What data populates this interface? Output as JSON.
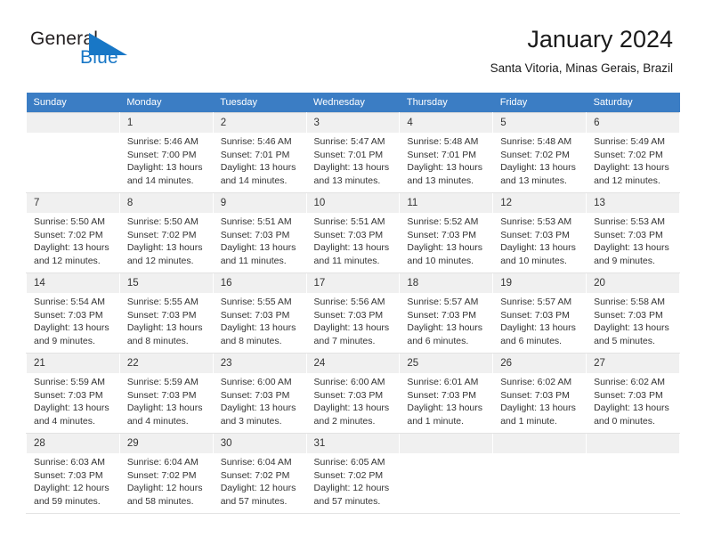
{
  "brand": {
    "name_part1": "General",
    "name_part2": "Blue",
    "logo_icon": "triangle-logo-icon",
    "accent_color": "#1877c6"
  },
  "header": {
    "title": "January 2024",
    "subtitle": "Santa Vitoria, Minas Gerais, Brazil"
  },
  "calendar": {
    "header_bg": "#3b7dc4",
    "weekday_headers": [
      "Sunday",
      "Monday",
      "Tuesday",
      "Wednesday",
      "Thursday",
      "Friday",
      "Saturday"
    ],
    "labels": {
      "sunrise": "Sunrise:",
      "sunset": "Sunset:",
      "daylight": "Daylight:"
    },
    "weeks": [
      [
        {
          "day": "",
          "sunrise": "",
          "sunset": "",
          "daylight_line1": "",
          "daylight_line2": ""
        },
        {
          "day": "1",
          "sunrise": "Sunrise: 5:46 AM",
          "sunset": "Sunset: 7:00 PM",
          "daylight_line1": "Daylight: 13 hours",
          "daylight_line2": "and 14 minutes."
        },
        {
          "day": "2",
          "sunrise": "Sunrise: 5:46 AM",
          "sunset": "Sunset: 7:01 PM",
          "daylight_line1": "Daylight: 13 hours",
          "daylight_line2": "and 14 minutes."
        },
        {
          "day": "3",
          "sunrise": "Sunrise: 5:47 AM",
          "sunset": "Sunset: 7:01 PM",
          "daylight_line1": "Daylight: 13 hours",
          "daylight_line2": "and 13 minutes."
        },
        {
          "day": "4",
          "sunrise": "Sunrise: 5:48 AM",
          "sunset": "Sunset: 7:01 PM",
          "daylight_line1": "Daylight: 13 hours",
          "daylight_line2": "and 13 minutes."
        },
        {
          "day": "5",
          "sunrise": "Sunrise: 5:48 AM",
          "sunset": "Sunset: 7:02 PM",
          "daylight_line1": "Daylight: 13 hours",
          "daylight_line2": "and 13 minutes."
        },
        {
          "day": "6",
          "sunrise": "Sunrise: 5:49 AM",
          "sunset": "Sunset: 7:02 PM",
          "daylight_line1": "Daylight: 13 hours",
          "daylight_line2": "and 12 minutes."
        }
      ],
      [
        {
          "day": "7",
          "sunrise": "Sunrise: 5:50 AM",
          "sunset": "Sunset: 7:02 PM",
          "daylight_line1": "Daylight: 13 hours",
          "daylight_line2": "and 12 minutes."
        },
        {
          "day": "8",
          "sunrise": "Sunrise: 5:50 AM",
          "sunset": "Sunset: 7:02 PM",
          "daylight_line1": "Daylight: 13 hours",
          "daylight_line2": "and 12 minutes."
        },
        {
          "day": "9",
          "sunrise": "Sunrise: 5:51 AM",
          "sunset": "Sunset: 7:03 PM",
          "daylight_line1": "Daylight: 13 hours",
          "daylight_line2": "and 11 minutes."
        },
        {
          "day": "10",
          "sunrise": "Sunrise: 5:51 AM",
          "sunset": "Sunset: 7:03 PM",
          "daylight_line1": "Daylight: 13 hours",
          "daylight_line2": "and 11 minutes."
        },
        {
          "day": "11",
          "sunrise": "Sunrise: 5:52 AM",
          "sunset": "Sunset: 7:03 PM",
          "daylight_line1": "Daylight: 13 hours",
          "daylight_line2": "and 10 minutes."
        },
        {
          "day": "12",
          "sunrise": "Sunrise: 5:53 AM",
          "sunset": "Sunset: 7:03 PM",
          "daylight_line1": "Daylight: 13 hours",
          "daylight_line2": "and 10 minutes."
        },
        {
          "day": "13",
          "sunrise": "Sunrise: 5:53 AM",
          "sunset": "Sunset: 7:03 PM",
          "daylight_line1": "Daylight: 13 hours",
          "daylight_line2": "and 9 minutes."
        }
      ],
      [
        {
          "day": "14",
          "sunrise": "Sunrise: 5:54 AM",
          "sunset": "Sunset: 7:03 PM",
          "daylight_line1": "Daylight: 13 hours",
          "daylight_line2": "and 9 minutes."
        },
        {
          "day": "15",
          "sunrise": "Sunrise: 5:55 AM",
          "sunset": "Sunset: 7:03 PM",
          "daylight_line1": "Daylight: 13 hours",
          "daylight_line2": "and 8 minutes."
        },
        {
          "day": "16",
          "sunrise": "Sunrise: 5:55 AM",
          "sunset": "Sunset: 7:03 PM",
          "daylight_line1": "Daylight: 13 hours",
          "daylight_line2": "and 8 minutes."
        },
        {
          "day": "17",
          "sunrise": "Sunrise: 5:56 AM",
          "sunset": "Sunset: 7:03 PM",
          "daylight_line1": "Daylight: 13 hours",
          "daylight_line2": "and 7 minutes."
        },
        {
          "day": "18",
          "sunrise": "Sunrise: 5:57 AM",
          "sunset": "Sunset: 7:03 PM",
          "daylight_line1": "Daylight: 13 hours",
          "daylight_line2": "and 6 minutes."
        },
        {
          "day": "19",
          "sunrise": "Sunrise: 5:57 AM",
          "sunset": "Sunset: 7:03 PM",
          "daylight_line1": "Daylight: 13 hours",
          "daylight_line2": "and 6 minutes."
        },
        {
          "day": "20",
          "sunrise": "Sunrise: 5:58 AM",
          "sunset": "Sunset: 7:03 PM",
          "daylight_line1": "Daylight: 13 hours",
          "daylight_line2": "and 5 minutes."
        }
      ],
      [
        {
          "day": "21",
          "sunrise": "Sunrise: 5:59 AM",
          "sunset": "Sunset: 7:03 PM",
          "daylight_line1": "Daylight: 13 hours",
          "daylight_line2": "and 4 minutes."
        },
        {
          "day": "22",
          "sunrise": "Sunrise: 5:59 AM",
          "sunset": "Sunset: 7:03 PM",
          "daylight_line1": "Daylight: 13 hours",
          "daylight_line2": "and 4 minutes."
        },
        {
          "day": "23",
          "sunrise": "Sunrise: 6:00 AM",
          "sunset": "Sunset: 7:03 PM",
          "daylight_line1": "Daylight: 13 hours",
          "daylight_line2": "and 3 minutes."
        },
        {
          "day": "24",
          "sunrise": "Sunrise: 6:00 AM",
          "sunset": "Sunset: 7:03 PM",
          "daylight_line1": "Daylight: 13 hours",
          "daylight_line2": "and 2 minutes."
        },
        {
          "day": "25",
          "sunrise": "Sunrise: 6:01 AM",
          "sunset": "Sunset: 7:03 PM",
          "daylight_line1": "Daylight: 13 hours",
          "daylight_line2": "and 1 minute."
        },
        {
          "day": "26",
          "sunrise": "Sunrise: 6:02 AM",
          "sunset": "Sunset: 7:03 PM",
          "daylight_line1": "Daylight: 13 hours",
          "daylight_line2": "and 1 minute."
        },
        {
          "day": "27",
          "sunrise": "Sunrise: 6:02 AM",
          "sunset": "Sunset: 7:03 PM",
          "daylight_line1": "Daylight: 13 hours",
          "daylight_line2": "and 0 minutes."
        }
      ],
      [
        {
          "day": "28",
          "sunrise": "Sunrise: 6:03 AM",
          "sunset": "Sunset: 7:03 PM",
          "daylight_line1": "Daylight: 12 hours",
          "daylight_line2": "and 59 minutes."
        },
        {
          "day": "29",
          "sunrise": "Sunrise: 6:04 AM",
          "sunset": "Sunset: 7:02 PM",
          "daylight_line1": "Daylight: 12 hours",
          "daylight_line2": "and 58 minutes."
        },
        {
          "day": "30",
          "sunrise": "Sunrise: 6:04 AM",
          "sunset": "Sunset: 7:02 PM",
          "daylight_line1": "Daylight: 12 hours",
          "daylight_line2": "and 57 minutes."
        },
        {
          "day": "31",
          "sunrise": "Sunrise: 6:05 AM",
          "sunset": "Sunset: 7:02 PM",
          "daylight_line1": "Daylight: 12 hours",
          "daylight_line2": "and 57 minutes."
        },
        {
          "day": "",
          "sunrise": "",
          "sunset": "",
          "daylight_line1": "",
          "daylight_line2": ""
        },
        {
          "day": "",
          "sunrise": "",
          "sunset": "",
          "daylight_line1": "",
          "daylight_line2": ""
        },
        {
          "day": "",
          "sunrise": "",
          "sunset": "",
          "daylight_line1": "",
          "daylight_line2": ""
        }
      ]
    ]
  }
}
